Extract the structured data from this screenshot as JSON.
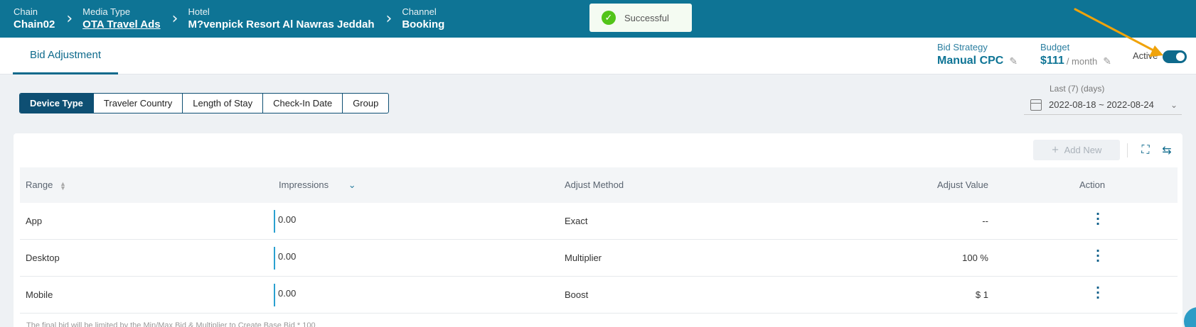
{
  "breadcrumb": [
    {
      "label": "Chain",
      "value": "Chain02",
      "link": false
    },
    {
      "label": "Media Type",
      "value": "OTA Travel Ads",
      "link": true
    },
    {
      "label": "Hotel",
      "value": "M?venpick Resort Al Nawras Jeddah",
      "link": false
    },
    {
      "label": "Channel",
      "value": "Booking",
      "link": false
    }
  ],
  "toast": {
    "icon": "check-circle-icon",
    "text": "Successful"
  },
  "subnav": {
    "tab": "Bid Adjustment",
    "bid_strategy": {
      "label": "Bid Strategy",
      "value": "Manual CPC"
    },
    "budget": {
      "label": "Budget",
      "value": "$111",
      "unit": "/ month"
    },
    "active_label": "Active",
    "active": true
  },
  "filters": [
    "Device Type",
    "Traveler Country",
    "Length of Stay",
    "Check-In Date",
    "Group"
  ],
  "filters_selected": "Device Type",
  "date_range": {
    "label": "Last (7) (days)",
    "value": "2022-08-18 ~ 2022-08-24"
  },
  "toolbar": {
    "add_new": "Add New"
  },
  "table": {
    "headers": {
      "range": "Range",
      "impressions": "Impressions",
      "adjust_method": "Adjust Method",
      "adjust_value": "Adjust Value",
      "action": "Action"
    },
    "rows": [
      {
        "range": "App",
        "impressions": "0.00",
        "adjust_method": "Exact",
        "adjust_value": "--"
      },
      {
        "range": "Desktop",
        "impressions": "0.00",
        "adjust_method": "Multiplier",
        "adjust_value": "100 %"
      },
      {
        "range": "Mobile",
        "impressions": "0.00",
        "adjust_method": "Boost",
        "adjust_value": "$ 1"
      }
    ]
  },
  "footnote": "The final bid will be limited by the Min/Max Bid & Multiplier to Create Base Bid * 100",
  "colors": {
    "header": "#0e7495",
    "accent": "#0e6a8c",
    "annotation": "#f0a30a"
  }
}
